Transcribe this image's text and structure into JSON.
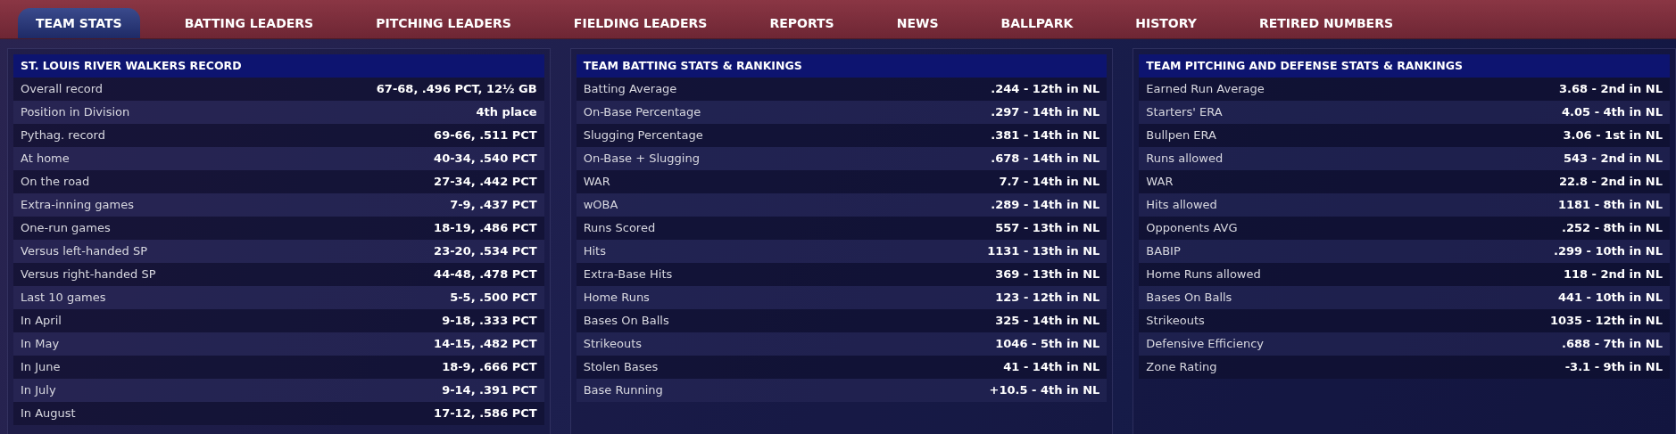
{
  "tabs": [
    {
      "label": "TEAM STATS",
      "selected": true
    },
    {
      "label": "BATTING LEADERS",
      "selected": false
    },
    {
      "label": "PITCHING LEADERS",
      "selected": false
    },
    {
      "label": "FIELDING LEADERS",
      "selected": false
    },
    {
      "label": "REPORTS",
      "selected": false
    },
    {
      "label": "NEWS",
      "selected": false
    },
    {
      "label": "BALLPARK",
      "selected": false
    },
    {
      "label": "HISTORY",
      "selected": false
    },
    {
      "label": "RETIRED NUMBERS",
      "selected": false
    }
  ],
  "panels": [
    {
      "title": "ST. LOUIS RIVER WALKERS RECORD",
      "rows": [
        {
          "label": "Overall record",
          "value": "67-68, .496 PCT, 12½ GB"
        },
        {
          "label": "Position in Division",
          "value": "4th place"
        },
        {
          "label": "Pythag. record",
          "value": "69-66, .511 PCT"
        },
        {
          "label": "At home",
          "value": "40-34, .540 PCT"
        },
        {
          "label": "On the road",
          "value": "27-34, .442 PCT"
        },
        {
          "label": "Extra-inning games",
          "value": "7-9, .437 PCT"
        },
        {
          "label": "One-run games",
          "value": "18-19, .486 PCT"
        },
        {
          "label": "Versus left-handed SP",
          "value": "23-20, .534 PCT"
        },
        {
          "label": "Versus right-handed SP",
          "value": "44-48, .478 PCT"
        },
        {
          "label": "Last 10 games",
          "value": "5-5, .500 PCT"
        },
        {
          "label": "In April",
          "value": "9-18, .333 PCT"
        },
        {
          "label": "In May",
          "value": "14-15, .482 PCT"
        },
        {
          "label": "In June",
          "value": "18-9, .666 PCT"
        },
        {
          "label": "In July",
          "value": "9-14, .391 PCT"
        },
        {
          "label": "In August",
          "value": "17-12, .586 PCT"
        }
      ]
    },
    {
      "title": "TEAM BATTING STATS & RANKINGS",
      "rows": [
        {
          "label": "Batting Average",
          "value": ".244 - 12th in NL"
        },
        {
          "label": "On-Base Percentage",
          "value": ".297 - 14th in NL"
        },
        {
          "label": "Slugging Percentage",
          "value": ".381 - 14th in NL"
        },
        {
          "label": "On-Base + Slugging",
          "value": ".678 - 14th in NL"
        },
        {
          "label": "WAR",
          "value": "7.7 - 14th in NL"
        },
        {
          "label": "wOBA",
          "value": ".289 - 14th in NL"
        },
        {
          "label": "Runs Scored",
          "value": "557 - 13th in NL"
        },
        {
          "label": "Hits",
          "value": "1131 - 13th in NL"
        },
        {
          "label": "Extra-Base Hits",
          "value": "369 - 13th in NL"
        },
        {
          "label": "Home Runs",
          "value": "123 - 12th in NL"
        },
        {
          "label": "Bases On Balls",
          "value": "325 - 14th in NL"
        },
        {
          "label": "Strikeouts",
          "value": "1046 - 5th in NL"
        },
        {
          "label": "Stolen Bases",
          "value": "41 - 14th in NL"
        },
        {
          "label": "Base Running",
          "value": "+10.5 - 4th in NL"
        }
      ]
    },
    {
      "title": "TEAM PITCHING AND DEFENSE STATS & RANKINGS",
      "rows": [
        {
          "label": "Earned Run Average",
          "value": "3.68 - 2nd in NL"
        },
        {
          "label": "Starters' ERA",
          "value": "4.05 - 4th in NL"
        },
        {
          "label": "Bullpen ERA",
          "value": "3.06 - 1st in NL"
        },
        {
          "label": "Runs allowed",
          "value": "543 - 2nd in NL"
        },
        {
          "label": "WAR",
          "value": "22.8 - 2nd in NL"
        },
        {
          "label": "Hits allowed",
          "value": "1181 - 8th in NL"
        },
        {
          "label": "Opponents AVG",
          "value": ".252 - 8th in NL"
        },
        {
          "label": "BABIP",
          "value": ".299 - 10th in NL"
        },
        {
          "label": "Home Runs allowed",
          "value": "118 - 2nd in NL"
        },
        {
          "label": "Bases On Balls",
          "value": "441 - 10th in NL"
        },
        {
          "label": "Strikeouts",
          "value": "1035 - 12th in NL"
        },
        {
          "label": "Defensive Efficiency",
          "value": ".688 - 7th in NL"
        },
        {
          "label": "Zone Rating",
          "value": "-3.1 - 9th in NL"
        }
      ]
    }
  ]
}
